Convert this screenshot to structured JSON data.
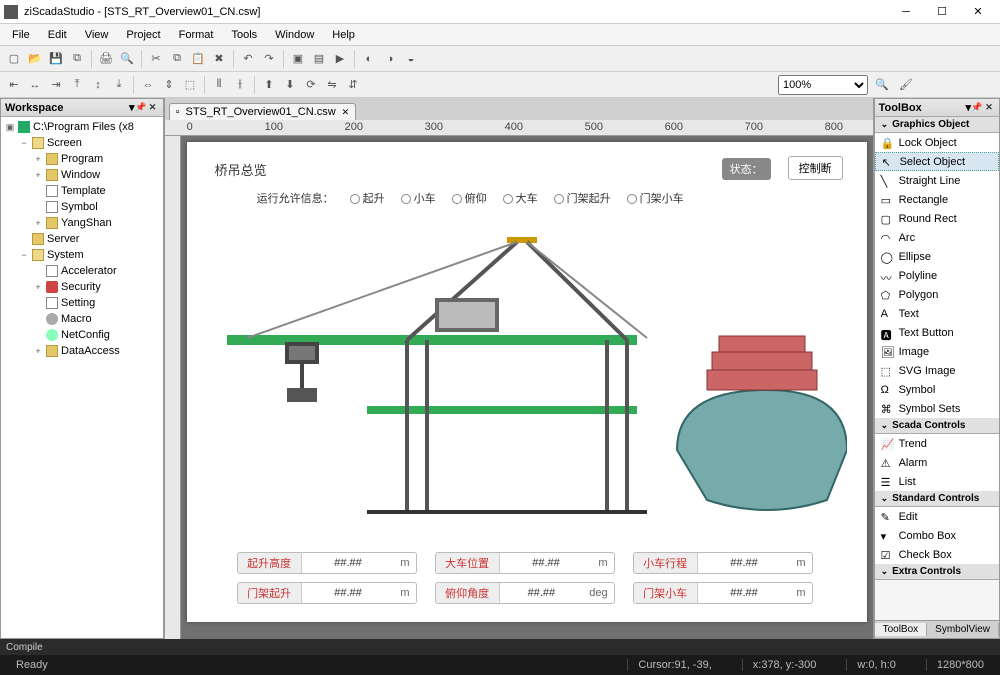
{
  "app": {
    "name": "ziScadaStudio",
    "doc": "[STS_RT_Overview01_CN.csw]"
  },
  "menus": [
    "File",
    "Edit",
    "View",
    "Project",
    "Format",
    "Tools",
    "Window",
    "Help"
  ],
  "zoom": {
    "value": "100%"
  },
  "workspace": {
    "title": "Workspace",
    "root": "C:\\Program Files (x8",
    "screen": {
      "label": "Screen",
      "program": "Program",
      "window": "Window",
      "template": "Template",
      "symbol": "Symbol",
      "yangshan": "YangShan"
    },
    "server": "Server",
    "system": {
      "label": "System",
      "accelerator": "Accelerator",
      "security": "Security",
      "setting": "Setting",
      "macro": "Macro",
      "netconfig": "NetConfig",
      "dataaccess": "DataAccess"
    }
  },
  "tab": {
    "name": "STS_RT_Overview01_CN.csw"
  },
  "ruler_marks": [
    "0",
    "100",
    "200",
    "300",
    "400",
    "500",
    "600",
    "700",
    "800"
  ],
  "canvas": {
    "title": "桥吊总览",
    "status_label": "状态：",
    "control_button": "控制断",
    "run_info_label": "运行允许信息：",
    "run_items": [
      "起升",
      "小车",
      "俯仰",
      "大车",
      "门架起升",
      "门架小车"
    ],
    "fields": [
      {
        "label": "起升高度",
        "value": "##.##",
        "unit": "m"
      },
      {
        "label": "大车位置",
        "value": "##.##",
        "unit": "m"
      },
      {
        "label": "小车行程",
        "value": "##.##",
        "unit": "m"
      },
      {
        "label": "门架起升",
        "value": "##.##",
        "unit": "m"
      },
      {
        "label": "俯仰角度",
        "value": "##.##",
        "unit": "deg"
      },
      {
        "label": "门架小车",
        "value": "##.##",
        "unit": "m"
      }
    ]
  },
  "toolbox": {
    "title": "ToolBox",
    "sections": {
      "graphics": {
        "title": "Graphics Object",
        "items": [
          "Lock Object",
          "Select Object",
          "Straight Line",
          "Rectangle",
          "Round Rect",
          "Arc",
          "Ellipse",
          "Polyline",
          "Polygon",
          "Text",
          "Text Button",
          "Image",
          "SVG Image",
          "Symbol",
          "Symbol Sets"
        ]
      },
      "scada": {
        "title": "Scada Controls",
        "items": [
          "Trend",
          "Alarm",
          "List"
        ]
      },
      "standard": {
        "title": "Standard Controls",
        "items": [
          "Edit",
          "Combo Box",
          "Check Box"
        ]
      },
      "extra": {
        "title": "Extra Controls"
      }
    },
    "bottom_tabs": [
      "ToolBox",
      "SymbolView"
    ]
  },
  "compile": "Compile",
  "status": {
    "ready": "Ready",
    "cursor": "Cursor:91, -39,",
    "pos": "x:378, y:-300",
    "size": "w:0,  h:0",
    "dim": "1280*800"
  }
}
